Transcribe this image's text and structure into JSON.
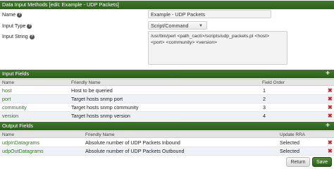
{
  "header": {
    "title": "Data Input Methods [edit: Example - UDP Packets]"
  },
  "form": {
    "name_label": "Name",
    "name_value": "Example - UDP Packets",
    "type_label": "Input Type",
    "type_value": "Script/Command",
    "string_label": "Input String",
    "string_line1": "/usr/bin/perl <path_cacti>/scripts/udp_packets.pl <host>",
    "string_line2": "<port> <community> <version>",
    "help_glyph": "?"
  },
  "input_fields": {
    "title": "Input Fields",
    "add_glyph": "+",
    "columns": [
      "Name",
      "Friendly Name",
      "Field Order"
    ],
    "rows": [
      {
        "name": "host",
        "friendly": "Host to be queried",
        "order": "1"
      },
      {
        "name": "port",
        "friendly": "Target hosts snmp port",
        "order": "2"
      },
      {
        "name": "community",
        "friendly": "Target hosts snmp community",
        "order": "3"
      },
      {
        "name": "version",
        "friendly": "Target hosts snmp version",
        "order": "4"
      }
    ]
  },
  "output_fields": {
    "title": "Output Fields",
    "add_glyph": "+",
    "columns": [
      "Name",
      "Friendly Name",
      "Update RRA"
    ],
    "rows": [
      {
        "name": "udpInDatagrams",
        "friendly": "Absolute number of UDP Packets Inbound",
        "rra": "Selected"
      },
      {
        "name": "udpOutDatagrams",
        "friendly": "Absolute number of UDP Packets Outbound",
        "rra": "Selected"
      }
    ]
  },
  "delete_glyph": "✖",
  "buttons": {
    "return": "Return",
    "save": "Save"
  },
  "colors": {
    "header_green": "#2d5e1d",
    "link_green": "#2d7a1f",
    "delete_red": "#d02020"
  }
}
